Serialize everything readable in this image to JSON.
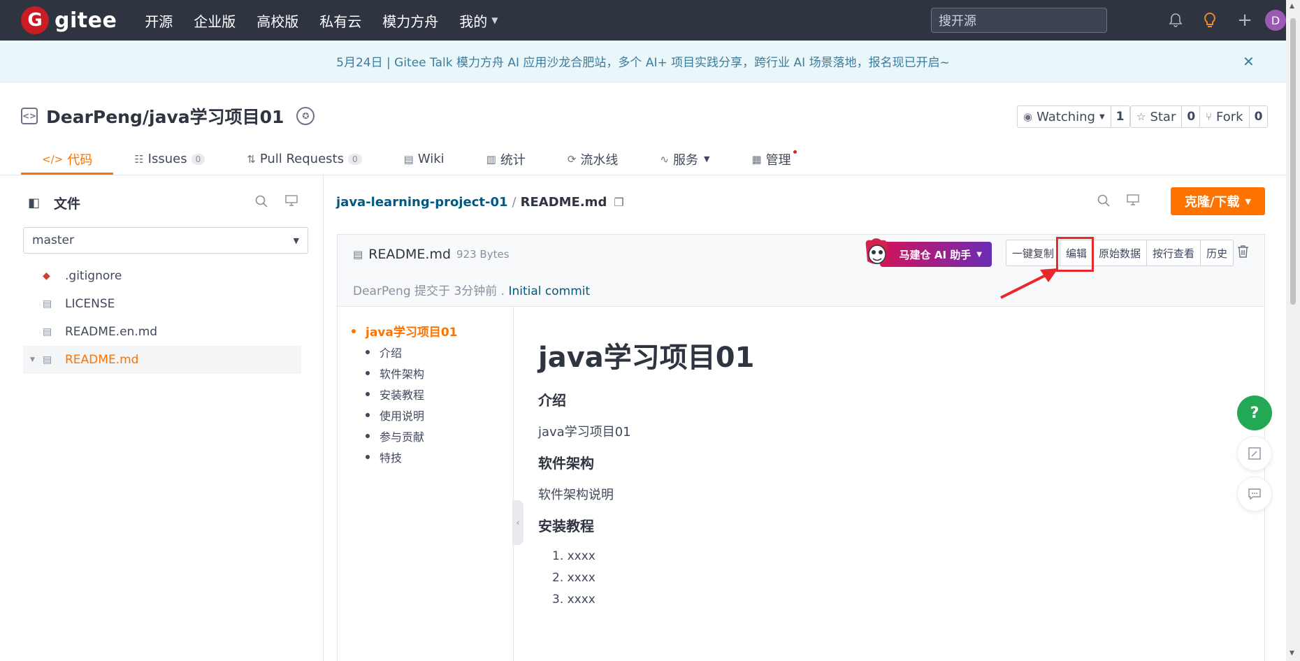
{
  "nav": {
    "logo_mark": "G",
    "logo_text": "gitee",
    "items": [
      "开源",
      "企业版",
      "高校版",
      "私有云",
      "模力方舟",
      "我的"
    ],
    "search_placeholder": "搜开源",
    "avatar_letter": "D"
  },
  "banner": {
    "text": "5月24日 | Gitee Talk 模力方舟 AI 应用沙龙合肥站，多个 AI+ 项目实践分享，跨行业 AI 场景落地，报名现已开启~",
    "close": "✕"
  },
  "project": {
    "name": "DearPeng/java学习项目01",
    "watching_label": "Watching",
    "watching_count": "1",
    "star_label": "Star",
    "star_count": "0",
    "fork_label": "Fork",
    "fork_count": "0"
  },
  "tabs": [
    {
      "label": "代码",
      "icon": "code-icon"
    },
    {
      "label": "Issues",
      "count": "0",
      "icon": "issues-icon"
    },
    {
      "label": "Pull Requests",
      "count": "0",
      "icon": "pull-request-icon"
    },
    {
      "label": "Wiki",
      "icon": "wiki-icon"
    },
    {
      "label": "统计",
      "icon": "stats-icon"
    },
    {
      "label": "流水线",
      "icon": "pipeline-icon"
    },
    {
      "label": "服务",
      "icon": "service-icon"
    },
    {
      "label": "管理",
      "icon": "manage-icon"
    }
  ],
  "sidebar": {
    "title": "文件",
    "branch": "master",
    "files": [
      ".gitignore",
      "LICENSE",
      "README.en.md",
      "README.md"
    ]
  },
  "breadcrumb": {
    "repo": "java-learning-project-01",
    "sep": "/",
    "file": "README.md"
  },
  "clone_label": "克隆/下载",
  "file": {
    "name": "README.md",
    "size": "923 Bytes",
    "author": "DearPeng",
    "commit_text": "提交于 3分钟前 .",
    "commit_msg": "Initial commit",
    "ai_label": "马建仓 AI 助手",
    "buttons": [
      "一键复制",
      "编辑",
      "原始数据",
      "按行查看",
      "历史"
    ]
  },
  "toc": [
    "java学习项目01",
    "介绍",
    "软件架构",
    "安装教程",
    "使用说明",
    "参与贡献",
    "特技"
  ],
  "markdown": {
    "h1": "java学习项目01",
    "intro_h": "介绍",
    "intro_p": "java学习项目01",
    "arch_h": "软件架构",
    "arch_p": "软件架构说明",
    "install_h": "安装教程",
    "install_items": [
      "1. xxxx",
      "2. xxxx",
      "3. xxxx"
    ]
  },
  "fab": {
    "help": "?"
  }
}
